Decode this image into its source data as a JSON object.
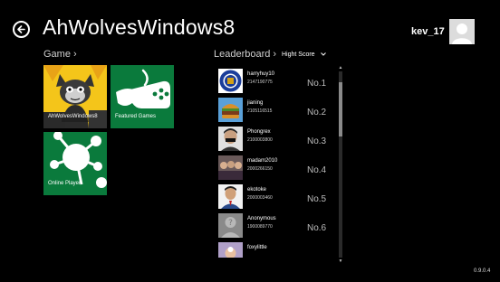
{
  "header": {
    "title": "AhWolvesWindows8",
    "username": "kev_17"
  },
  "game_section": {
    "title": "Game",
    "chevron": "›",
    "tiles": [
      {
        "label": "AhWolvesWindows8",
        "icon": "wolf-cartoon-icon"
      },
      {
        "label": "Featured Games",
        "icon": "gamepad-icon"
      },
      {
        "label": "Online Player",
        "icon": "network-icon"
      }
    ]
  },
  "leaderboard": {
    "title": "Leaderboard",
    "chevron": "›",
    "sort_value": "Hight Score",
    "rows": [
      {
        "name": "harryhuy10",
        "score": "2147190775",
        "rank": "No.1"
      },
      {
        "name": "jianing",
        "score": "2105116515",
        "rank": "No.2"
      },
      {
        "name": "Phongrex",
        "score": "2100003800",
        "rank": "No.3"
      },
      {
        "name": "madam2010",
        "score": "2000266150",
        "rank": "No.4"
      },
      {
        "name": "ekotoke",
        "score": "2000003460",
        "rank": "No.5"
      },
      {
        "name": "Anonymous",
        "score": "1900089770",
        "rank": "No.6"
      },
      {
        "name": "foxylittle",
        "score": "",
        "rank": ""
      }
    ]
  },
  "footer": {
    "version": "0.9.0.4"
  },
  "colors": {
    "background": "#000000",
    "tile_green": "#0a7a3c",
    "text": "#ffffff"
  }
}
